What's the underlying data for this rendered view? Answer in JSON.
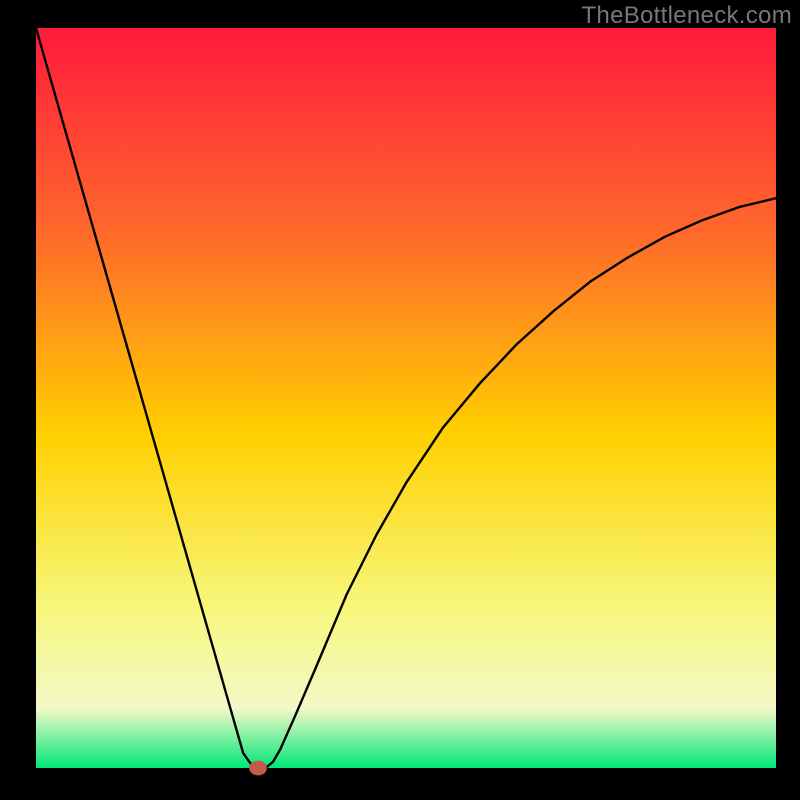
{
  "attribution": "TheBottleneck.com",
  "colors": {
    "frame": "#000000",
    "curve": "#000000",
    "marker_fill": "#c65a4a",
    "gradient_top": "#ff1a3c",
    "gradient_mid_upper": "#ff6a2a",
    "gradient_mid": "#ffd000",
    "gradient_mid_lower": "#f7f77a",
    "gradient_low": "#f3f8c8",
    "gradient_bottom": "#00e878"
  },
  "chart_data": {
    "type": "line",
    "title": "",
    "xlabel": "",
    "ylabel": "",
    "xlim": [
      0,
      100
    ],
    "ylim": [
      0,
      100
    ],
    "grid": false,
    "legend": false,
    "series": [
      {
        "name": "bottleneck-curve",
        "x": [
          0,
          2,
          4,
          6,
          8,
          10,
          12,
          14,
          16,
          18,
          20,
          22,
          24,
          26,
          27,
          28,
          29,
          30,
          31,
          32,
          33,
          35,
          38,
          42,
          46,
          50,
          55,
          60,
          65,
          70,
          75,
          80,
          85,
          90,
          95,
          100
        ],
        "y": [
          100,
          93.0,
          86.0,
          79.0,
          72.0,
          65.0,
          58.0,
          51.0,
          44.0,
          37.0,
          30.0,
          23.0,
          16.0,
          9.0,
          5.5,
          2.0,
          0.6,
          0.0,
          0.0,
          0.8,
          2.5,
          7.0,
          14.0,
          23.5,
          31.5,
          38.5,
          46.0,
          52.0,
          57.3,
          61.8,
          65.8,
          69.0,
          71.8,
          74.0,
          75.8,
          77.0
        ]
      }
    ],
    "marker": {
      "x": 30,
      "y": 0,
      "rx": 1.2,
      "ry": 1.0
    },
    "annotations": []
  }
}
